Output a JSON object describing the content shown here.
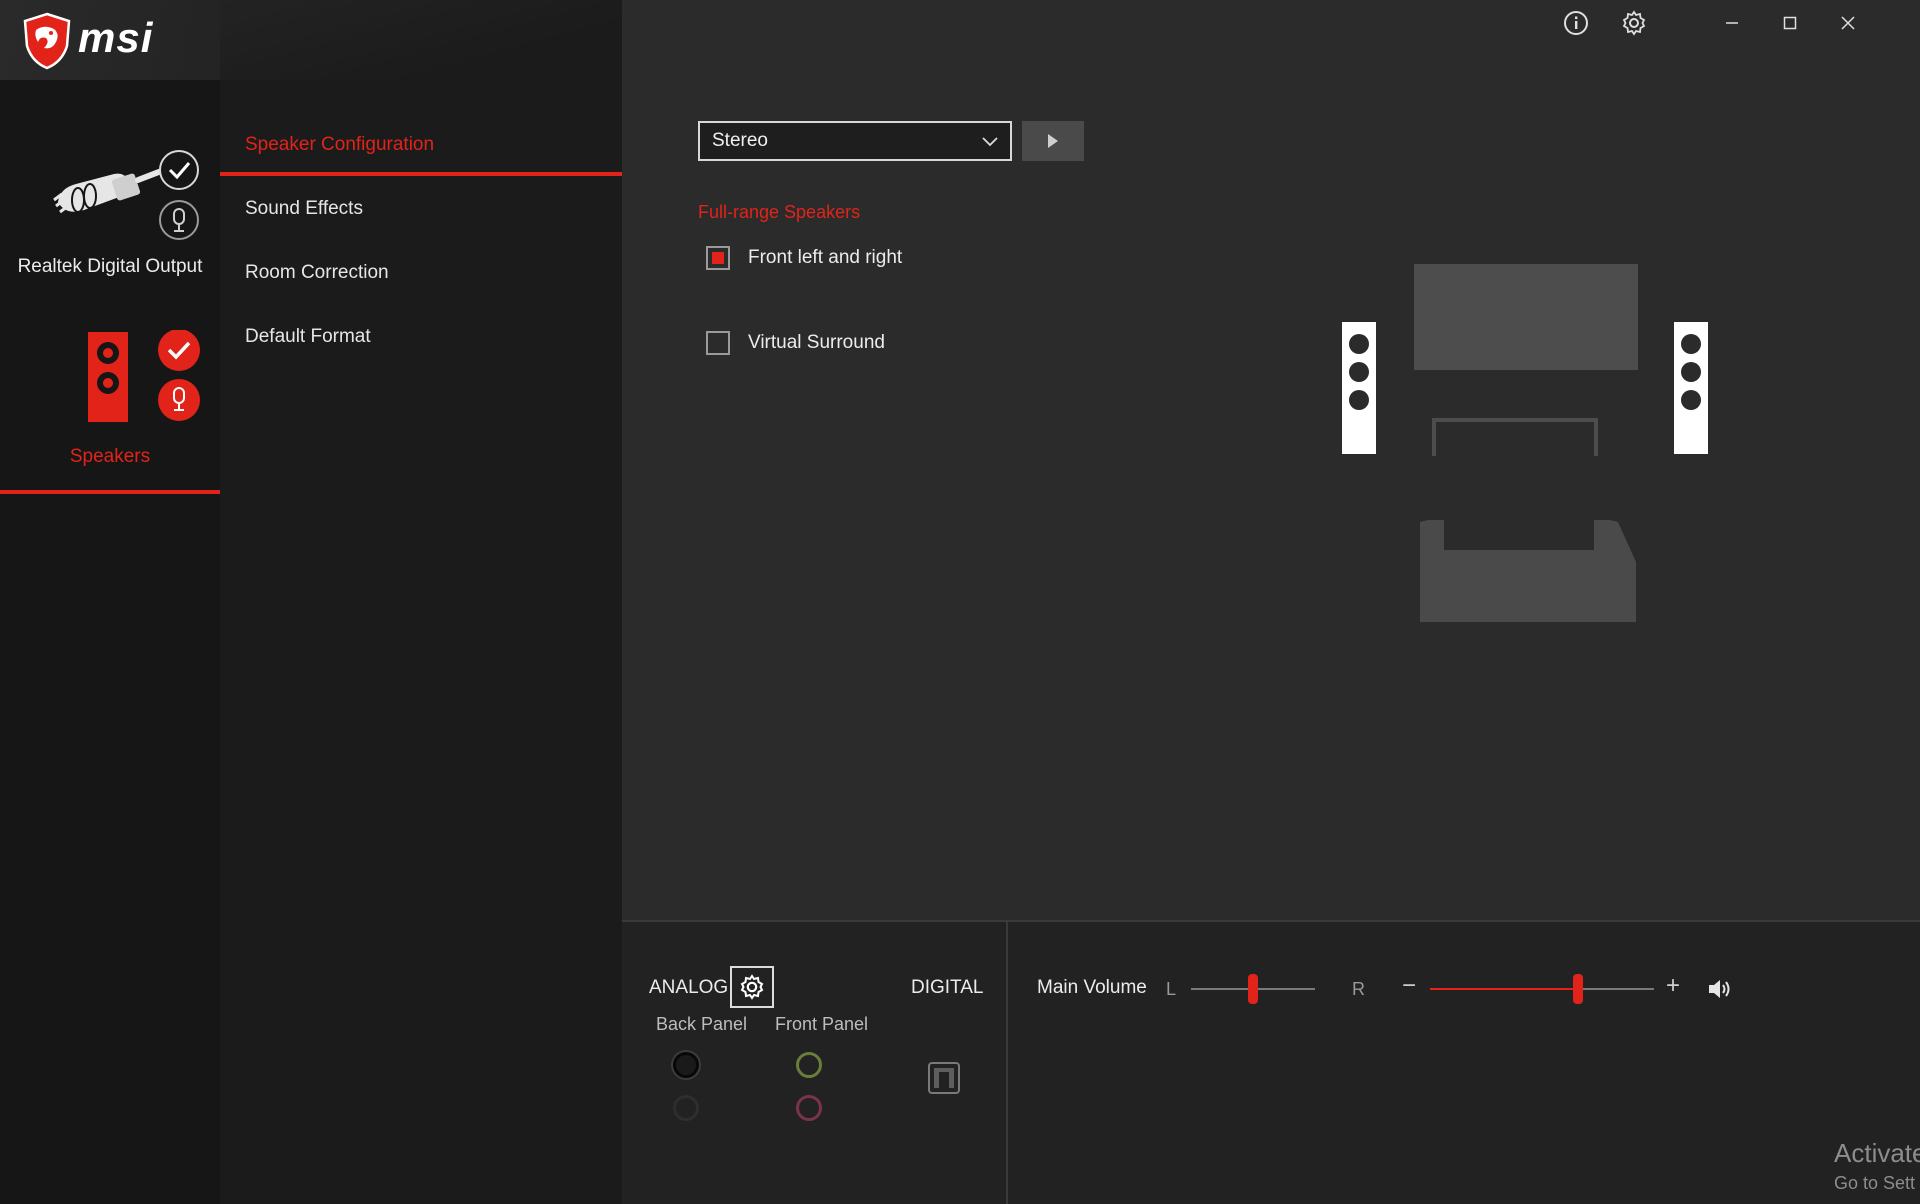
{
  "brand": {
    "name": "msi"
  },
  "devices": [
    {
      "label": "Realtek Digital Output",
      "status": "connected",
      "icon": "digital-cable-icon"
    },
    {
      "label": "Speakers",
      "status": "active",
      "icon": "speaker-icon"
    }
  ],
  "nav": {
    "items": [
      {
        "label": "Speaker Configuration",
        "active": true
      },
      {
        "label": "Sound Effects",
        "active": false
      },
      {
        "label": "Room Correction",
        "active": false
      },
      {
        "label": "Default Format",
        "active": false
      }
    ]
  },
  "window": {
    "icons": [
      "info-icon",
      "settings-icon",
      "minimize-icon",
      "maximize-icon",
      "close-icon"
    ]
  },
  "speaker_config": {
    "selected": "Stereo",
    "section_heading": "Full-range Speakers",
    "options": [
      {
        "label": "Front left and right",
        "checked": true
      },
      {
        "label": "Virtual Surround",
        "checked": false
      }
    ]
  },
  "jacks": {
    "analog_label": "ANALOG",
    "digital_label": "DIGITAL",
    "back_panel_label": "Back Panel",
    "front_panel_label": "Front Panel"
  },
  "volume": {
    "label": "Main Volume",
    "balance_left": "L",
    "balance_right": "R",
    "balance_fraction": 0.5,
    "minus": "−",
    "plus": "+",
    "level_fraction": 0.66
  },
  "watermark": {
    "line1": "Activate",
    "line2": "Go to Sett"
  },
  "colors": {
    "accent": "#e2231a",
    "panel": "#2b2b2b",
    "sidebar": "#161616"
  }
}
